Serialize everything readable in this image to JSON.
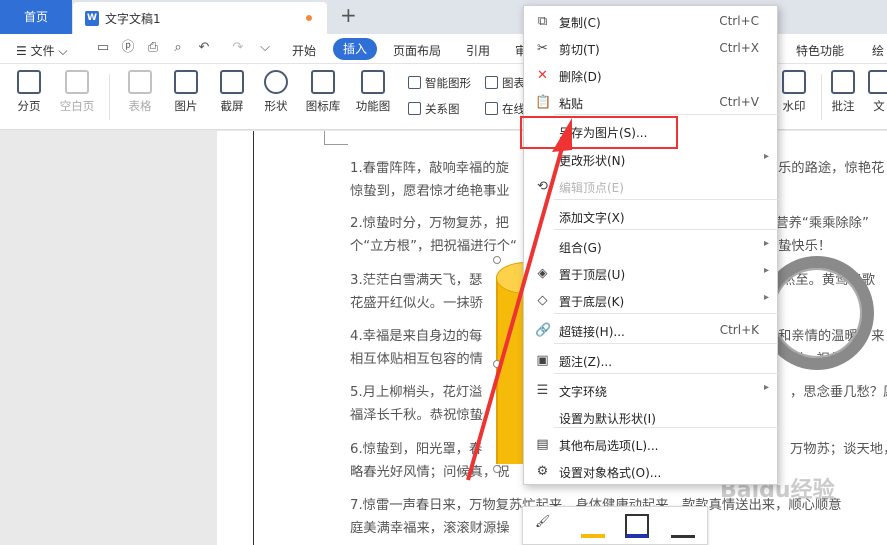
{
  "tabs": {
    "home": "首页",
    "doc_icon": "W",
    "doc_title": "文字文稿1",
    "plus": "+"
  },
  "menu": {
    "file": "文件",
    "items": [
      "开始",
      "插入",
      "页面布局",
      "引用",
      "审"
    ],
    "right": [
      "特色功能",
      "绘"
    ]
  },
  "ribbon": {
    "large": [
      "分页",
      "空白页",
      "表格",
      "图片",
      "截屏",
      "形状",
      "图标库",
      "功能图"
    ],
    "small": [
      "智能图形",
      "关系图",
      "图表",
      "在线"
    ],
    "right": [
      "水印",
      "批注",
      "文"
    ]
  },
  "paragraphs": [
    [
      "1.春雷阵阵，敲响幸福的旋",
      "乐的路途，惊艳花"
    ],
    [
      "惊蛰到，愿君惊才绝艳事业",
      ""
    ],
    [
      "2.惊蛰时分，万物复苏，把",
      "把营养“乘乘除除”"
    ],
    [
      "个“立方根”，把祝福进行个“",
      "蛰快乐！"
    ],
    [
      "3.茫茫白雪满天飞，瑟",
      "然至。黄莺鸣歌"
    ],
    [
      "花盛开红似火。一抹骄",
      ""
    ],
    [
      "4.幸福是来自身边的每",
      "和亲情的温暖，来"
    ],
    [
      "相互体贴相互包容的情",
      "到，祝你"
    ],
    [
      "5.月上柳梢头，花灯溢",
      "，思念垂几愁？愿"
    ],
    [
      "福泽长千秋。恭祝惊蛰",
      ""
    ],
    [
      "6.惊蛰到，阳光罩，春",
      "万物苏；谈天地，"
    ],
    [
      "略春光好风情；问候真，祝",
      ""
    ],
    [
      "7.惊雷一声春日来，万物复苏忙起来。身体健康动起来，",
      "款款真情送出来，顺心顺意"
    ],
    [
      "庭美满幸福来，滚滚财源操",
      ""
    ]
  ],
  "context_menu": [
    {
      "label": "复制(C)",
      "shortcut": "Ctrl+C",
      "icon": "copy-icon",
      "glyph": "⧉"
    },
    {
      "label": "剪切(T)",
      "shortcut": "Ctrl+X",
      "icon": "scissors-icon",
      "glyph": "✂"
    },
    {
      "label": "删除(D)",
      "shortcut": "",
      "icon": "delete-icon",
      "glyph": "✕"
    },
    {
      "label": "粘贴",
      "shortcut": "Ctrl+V",
      "icon": "paste-icon",
      "glyph": "📋"
    },
    {
      "label": "另存为图片(S)...",
      "shortcut": "",
      "icon": "",
      "glyph": ""
    },
    {
      "label": "更改形状(N)",
      "shortcut": "",
      "icon": "",
      "glyph": ""
    },
    {
      "label": "编辑顶点(E)",
      "shortcut": "",
      "icon": "edit-points-icon",
      "glyph": "⟲"
    },
    {
      "label": "添加文字(X)",
      "shortcut": "",
      "icon": "",
      "glyph": ""
    },
    {
      "label": "组合(G)",
      "shortcut": "",
      "icon": "",
      "glyph": ""
    },
    {
      "label": "置于顶层(U)",
      "shortcut": "",
      "icon": "bring-front-icon",
      "glyph": "◈"
    },
    {
      "label": "置于底层(K)",
      "shortcut": "",
      "icon": "send-back-icon",
      "glyph": "◇"
    },
    {
      "label": "超链接(H)...",
      "shortcut": "Ctrl+K",
      "icon": "link-icon",
      "glyph": "🔗"
    },
    {
      "label": "题注(Z)...",
      "shortcut": "",
      "icon": "caption-icon",
      "glyph": "▣"
    },
    {
      "label": "文字环绕",
      "shortcut": "",
      "icon": "text-wrap-icon",
      "glyph": "☰"
    },
    {
      "label": "设置为默认形状(I)",
      "shortcut": "",
      "icon": "",
      "glyph": ""
    },
    {
      "label": "其他布局选项(L)...",
      "shortcut": "",
      "icon": "layout-icon",
      "glyph": "▤"
    },
    {
      "label": "设置对象格式(O)...",
      "shortcut": "",
      "icon": "format-icon",
      "glyph": "⚙"
    }
  ],
  "watermark": "Baidu经验",
  "colors": {
    "accent": "#2f6fd6",
    "highlight": "#e33333",
    "shape_fill": "#f6bb0a"
  }
}
